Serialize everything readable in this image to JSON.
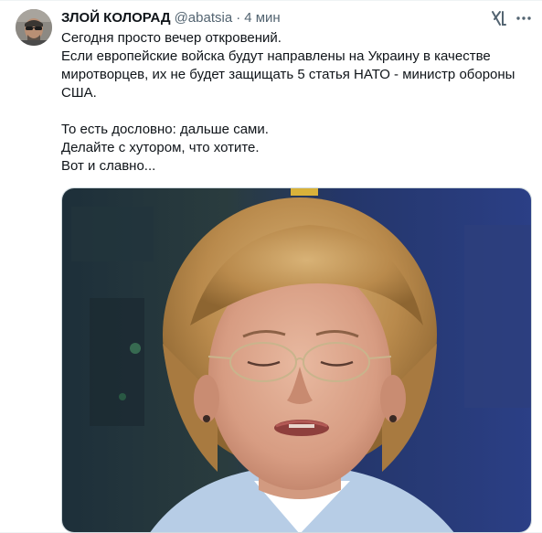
{
  "tweet": {
    "author": {
      "display_name": "ЗЛОЙ КОЛОРАД",
      "handle": "@abatsia",
      "separator": "·",
      "time": "4 мин"
    },
    "text_lines": [
      "Сегодня просто вечер откровений.",
      "Если европейские войска будут направлены на Украину в качестве",
      "миротворцев, их не будет защищать 5 статья НАТО - министр обороны",
      "США.",
      "",
      "То есть дословно: дальше сами.",
      "Делайте с хутором, что хотите.",
      "Вот и славно..."
    ],
    "icons": {
      "grok": "grok-icon",
      "more": "more-options-icon",
      "avatar": "avatar-image"
    },
    "colors": {
      "text": "#0f1419",
      "secondary": "#536471",
      "border": "#cfd9de"
    }
  }
}
